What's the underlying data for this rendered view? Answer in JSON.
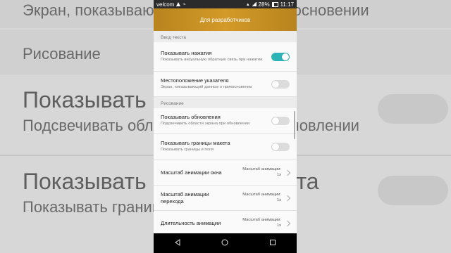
{
  "background": {
    "line1": "Экран, показывающий данные о прикосновении",
    "section": "Рисование",
    "line2": "Показывать обновления",
    "line3": "Подсвечивать области экрана при обновлении",
    "line4": "Показывать границы макета",
    "line5": "Показывать границы и поля"
  },
  "status": {
    "carrier": "velcom",
    "battery": "28%",
    "time": "11:17"
  },
  "title": "Для разработчиков",
  "sections": {
    "input": "Ввод текста",
    "drawing": "Рисование"
  },
  "settings": [
    {
      "title": "Показывать нажатия",
      "subtitle": "Показывать визуальную обратную связь при нажатии",
      "toggle": true
    },
    {
      "title": "Местоположение указателя",
      "subtitle": "Экран, показывающий данные о прикосновении",
      "toggle": false
    },
    {
      "title": "Показывать обновления",
      "subtitle": "Подсвечивать области экрана при обновлении",
      "toggle": false
    },
    {
      "title": "Показывать границы макета",
      "subtitle": "Показывать границы и поля",
      "toggle": false
    },
    {
      "title": "Масштаб анимации окна",
      "value": "Масштаб анимации: 1x"
    },
    {
      "title": "Масштаб анимации перехода",
      "value": "Масштаб анимации: 1x"
    },
    {
      "title": "Длительность анимации",
      "value": "Масштаб анимации: 1x"
    }
  ],
  "colors": {
    "accent": "#2bb3b8",
    "titlebar": "#c8922a"
  }
}
